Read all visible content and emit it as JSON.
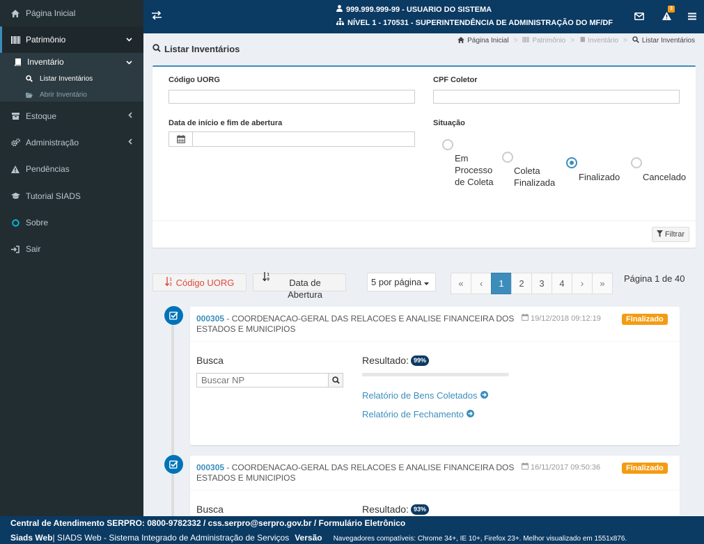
{
  "sidebar": {
    "items": [
      {
        "label": "Página Inicial",
        "icon": "home-icon"
      },
      {
        "label": "Patrimônio",
        "icon": "barcode-icon"
      },
      {
        "label": "Estoque",
        "icon": "archive-icon"
      },
      {
        "label": "Administração",
        "icon": "cogs-icon"
      },
      {
        "label": "Pendências",
        "icon": "warning-icon"
      },
      {
        "label": "Tutorial SIADS",
        "icon": "graduation-cap-icon"
      },
      {
        "label": "Sobre",
        "icon": "circle-icon"
      },
      {
        "label": "Sair",
        "icon": "sign-in-icon"
      }
    ],
    "sub": {
      "label": "Inventário",
      "icon": "book-icon"
    },
    "subsub": [
      {
        "label": "Listar Inventários",
        "icon": "search-icon"
      },
      {
        "label": "Abrir Inventário",
        "icon": "folder-open-icon"
      }
    ]
  },
  "topbar": {
    "user": "999.999.999-99 - USUARIO DO SISTEMA",
    "level": "NÍVEL 1 - 170531 - SUPERINTENDÊNCIA DE ADMINISTRAÇÃO DO MF/DF",
    "alert_count": "3"
  },
  "page": {
    "title": "Listar Inventários",
    "breadcrumb": [
      "Página Inicial",
      "Patrimônio",
      "Inventário",
      "Listar Inventários"
    ]
  },
  "filter": {
    "codigo_uorg_label": "Código UORG",
    "codigo_uorg_value": "",
    "cpf_coletor_label": "CPF Coletor",
    "cpf_coletor_value": "",
    "data_label": "Data de início e fim de abertura",
    "data_value": "",
    "situacao_label": "Situação",
    "situacao_options": [
      {
        "label": "Em Processo de Coleta",
        "checked": false
      },
      {
        "label": "Coleta Finalizada",
        "checked": false
      },
      {
        "label": "Finalizado",
        "checked": true
      },
      {
        "label": "Cancelado",
        "checked": false
      }
    ],
    "filtrar_label": "Filtrar"
  },
  "sorting": {
    "codigo_label": "Código UORG",
    "data_label": "Data de Abertura",
    "per_page": "5 por página"
  },
  "pagination": {
    "first": "«",
    "prev": "‹",
    "pages": [
      "1",
      "2",
      "3",
      "4"
    ],
    "next": "›",
    "last": "»",
    "current": "1",
    "info": "Página 1 de 40"
  },
  "inventories": [
    {
      "code": "000305",
      "title": " - COORDENACAO-GERAL DAS RELACOES E ANALISE FINANCEIRA DOS ESTADOS E MUNICIPIOS",
      "date": "19/12/2018 09:12:19",
      "status": "Finalizado",
      "busca_label": "Busca",
      "busca_placeholder": "Buscar NP",
      "result_label": "Resultado:",
      "result_pct": "99%",
      "progress": 0.99,
      "link1": "Relatório de Bens Coletados",
      "link2": "Relatório de Fechamento"
    },
    {
      "code": "000305",
      "title": " - COORDENACAO-GERAL DAS RELACOES E ANALISE FINANCEIRA DOS ESTADOS E MUNICIPIOS",
      "date": "16/11/2017 09:50:36",
      "status": "Finalizado",
      "busca_label": "Busca",
      "result_label": "Resultado:",
      "result_pct": "93%"
    }
  ],
  "footer": {
    "line1": "Central de Atendimento SERPRO: 0800-9782332 / css.serpro@serpro.gov.br / Formulário Eletrônico",
    "brand": "Siads Web",
    "desc": " | SIADS Web - Sistema Integrado de Administração de Serviços",
    "versao": "Versão",
    "compat": "Navegadores compatíveis: Chrome 34+, IE 10+, Firefox 23+. Melhor visualizado em 1551x876."
  },
  "colors": {
    "sidebar_bg": "#222d32",
    "topbar_bg": "#0b3a63",
    "accent": "#3c8dbc",
    "status_badge": "#f39c12",
    "sort_active": "#dd4b39"
  }
}
